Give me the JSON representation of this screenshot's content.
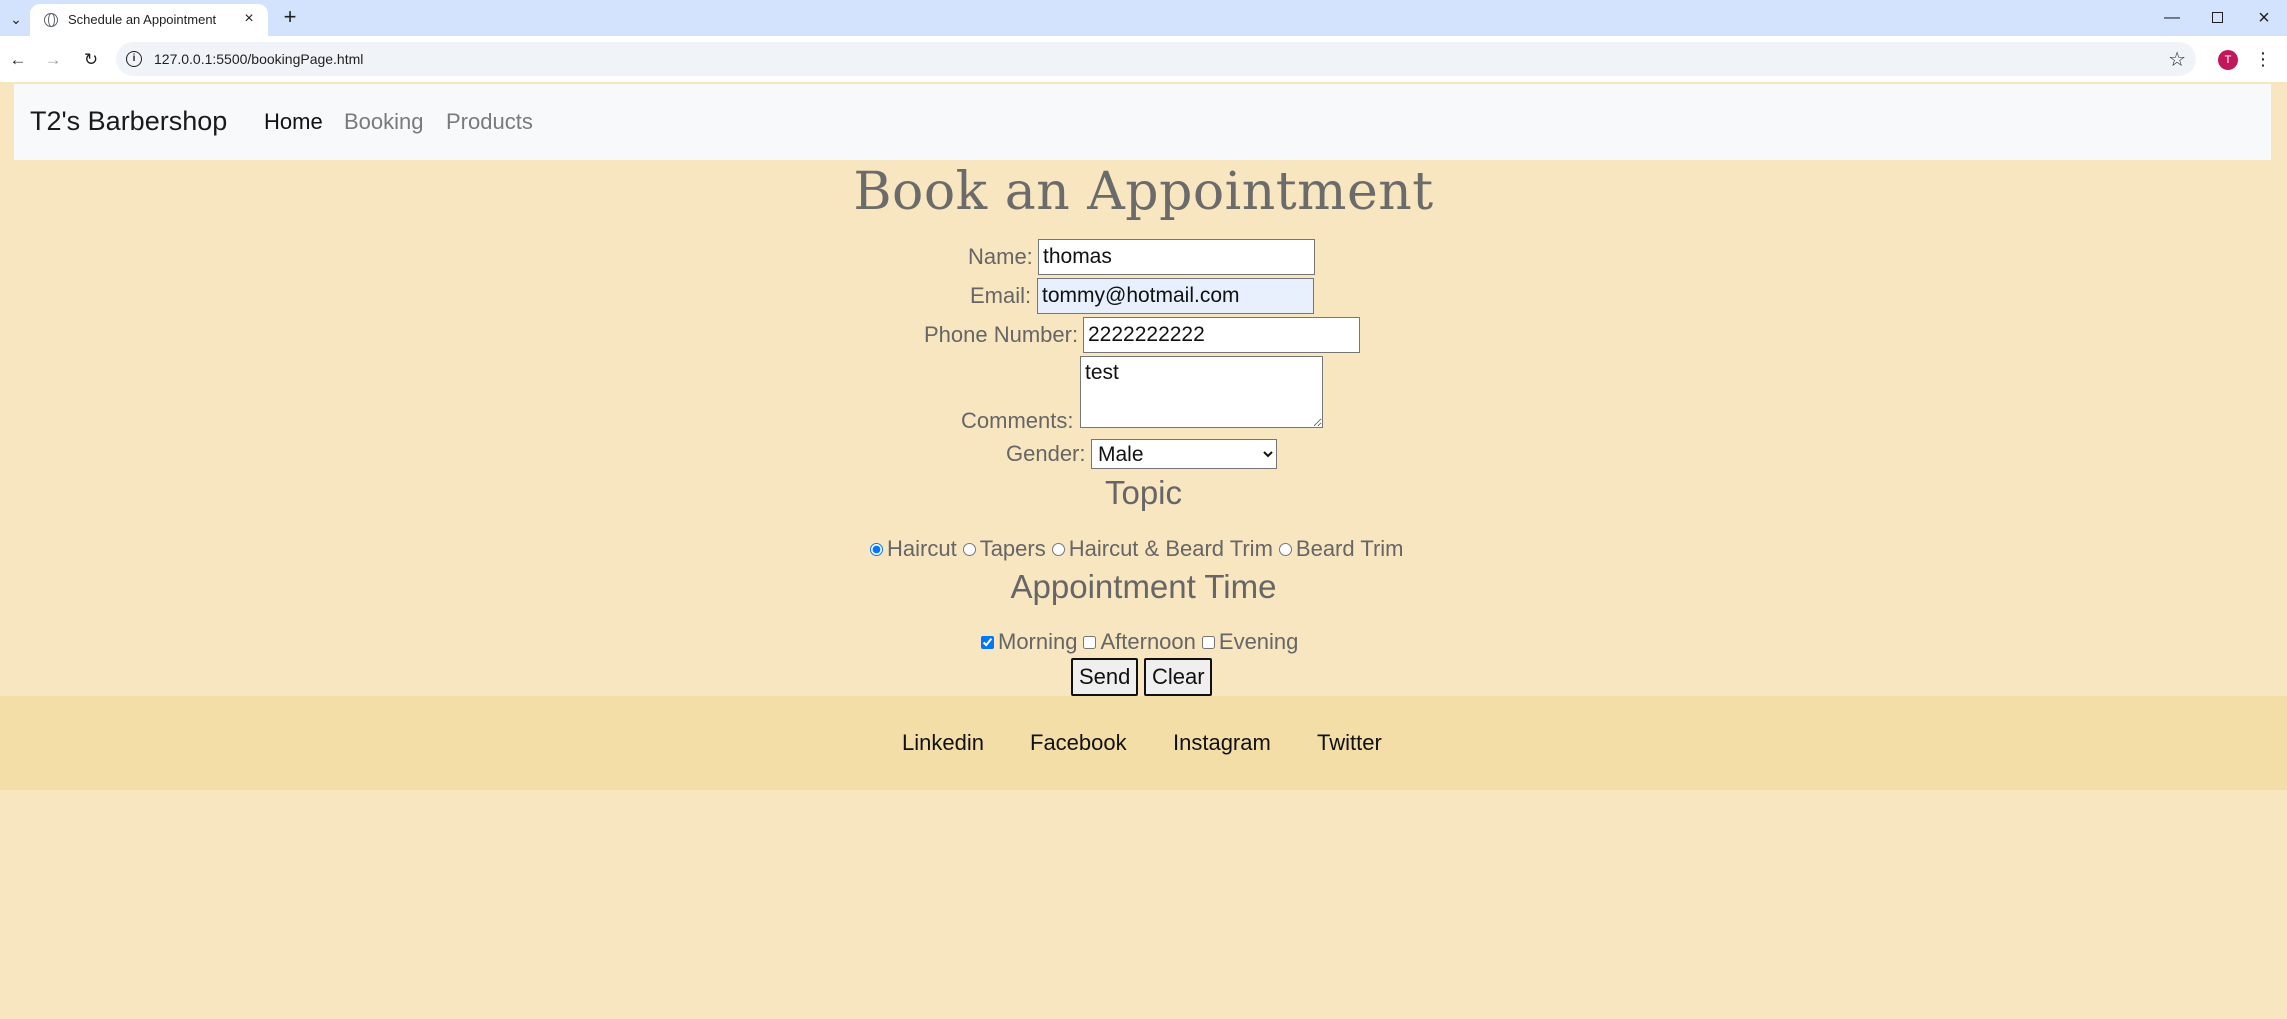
{
  "browser": {
    "tab_title": "Schedule an Appointment",
    "url": "127.0.0.1:5500/bookingPage.html",
    "profile_initial": "T",
    "icons": [
      "tab-list-icon",
      "globe-favicon-icon",
      "close-icon",
      "plus-icon",
      "minimize-icon",
      "maximize-icon",
      "window-close-icon",
      "back-arrow-icon",
      "forward-arrow-icon",
      "reload-icon",
      "site-info-icon",
      "bookmark-star-icon",
      "kebab-menu-icon"
    ]
  },
  "nav": {
    "brand": "T2's Barbershop",
    "links": [
      "Home",
      "Booking",
      "Products"
    ]
  },
  "form": {
    "heading": "Book an Appointment",
    "name_label": "Name:",
    "name_value": "thomas",
    "email_label": "Email:",
    "email_value": "tommy@hotmail.com",
    "phone_label": "Phone Number:",
    "phone_value": "2222222222",
    "comments_label": "Comments:",
    "comments_value": "test",
    "gender_label": "Gender:",
    "gender_value": "Male",
    "topic_title": "Topic",
    "topics": [
      "Haircut",
      "Tapers",
      "Haircut & Beard Trim",
      "Beard Trim"
    ],
    "topic_selected": "Haircut",
    "time_title": "Appointment Time",
    "times": [
      "Morning",
      "Afternoon",
      "Evening"
    ],
    "times_checked": [
      "Morning"
    ],
    "send_label": "Send",
    "clear_label": "Clear"
  },
  "footer": {
    "links": [
      "Linkedin",
      "Facebook",
      "Instagram",
      "Twitter"
    ]
  },
  "colors": {
    "page_bg": "#f7e6bf",
    "footer_bg": "#f4dea7",
    "navbar_bg": "#f8f9fb",
    "tabbar_bg": "#d3e3fd",
    "avatar": "#c2185b"
  }
}
